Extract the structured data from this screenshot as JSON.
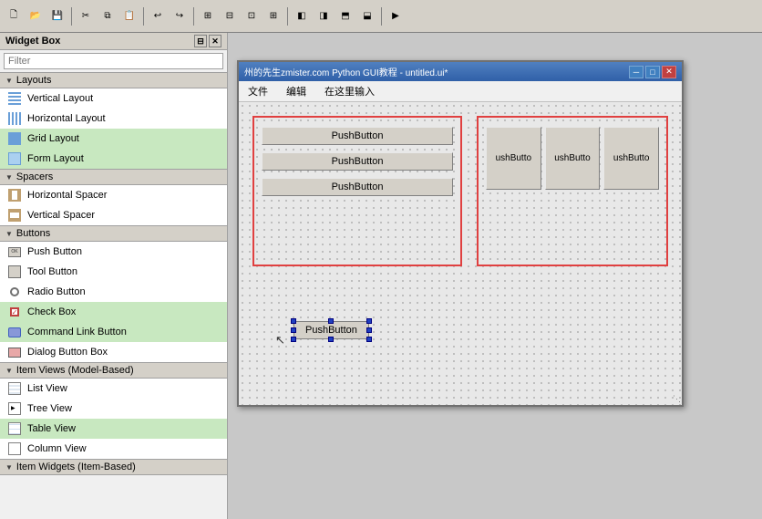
{
  "toolbar": {
    "buttons": [
      "new",
      "open",
      "save",
      "cut",
      "copy",
      "paste",
      "undo",
      "redo",
      "layout",
      "preview"
    ]
  },
  "widget_box": {
    "title": "Widget Box",
    "filter_placeholder": "Filter",
    "sections": [
      {
        "name": "Layouts",
        "items": [
          {
            "label": "Vertical Layout",
            "icon": "vlayout"
          },
          {
            "label": "Horizontal Layout",
            "icon": "hlayout"
          },
          {
            "label": "Grid Layout",
            "icon": "grid"
          },
          {
            "label": "Form Layout",
            "icon": "form"
          }
        ]
      },
      {
        "name": "Spacers",
        "items": [
          {
            "label": "Horizontal Spacer",
            "icon": "hspacer"
          },
          {
            "label": "Vertical Spacer",
            "icon": "vspacer"
          }
        ]
      },
      {
        "name": "Buttons",
        "items": [
          {
            "label": "Push Button",
            "icon": "pushbtn"
          },
          {
            "label": "Tool Button",
            "icon": "toolbtn"
          },
          {
            "label": "Radio Button",
            "icon": "radio"
          },
          {
            "label": "Check Box",
            "icon": "check"
          },
          {
            "label": "Command Link Button",
            "icon": "cmdlink"
          },
          {
            "label": "Dialog Button Box",
            "icon": "dialogbtn"
          }
        ]
      },
      {
        "name": "Item Views (Model-Based)",
        "items": [
          {
            "label": "List View",
            "icon": "listview"
          },
          {
            "label": "Tree View",
            "icon": "treeview"
          },
          {
            "label": "Table View",
            "icon": "tableview"
          },
          {
            "label": "Column View",
            "icon": "columnview"
          }
        ]
      },
      {
        "name": "Item Widgets (Item-Based)",
        "items": []
      }
    ]
  },
  "qt_window": {
    "title": "州的先生zmister.com Python GUI教程 - untitled.ui*",
    "menu": [
      "文件",
      "编辑",
      "在这里输入"
    ],
    "buttons_col1": [
      "PushButton",
      "PushButton",
      "PushButton"
    ],
    "buttons_grid": [
      "ushButto",
      "ushButto",
      "ushButto"
    ],
    "selected_button": "PushButton",
    "resize_hint": "..."
  }
}
